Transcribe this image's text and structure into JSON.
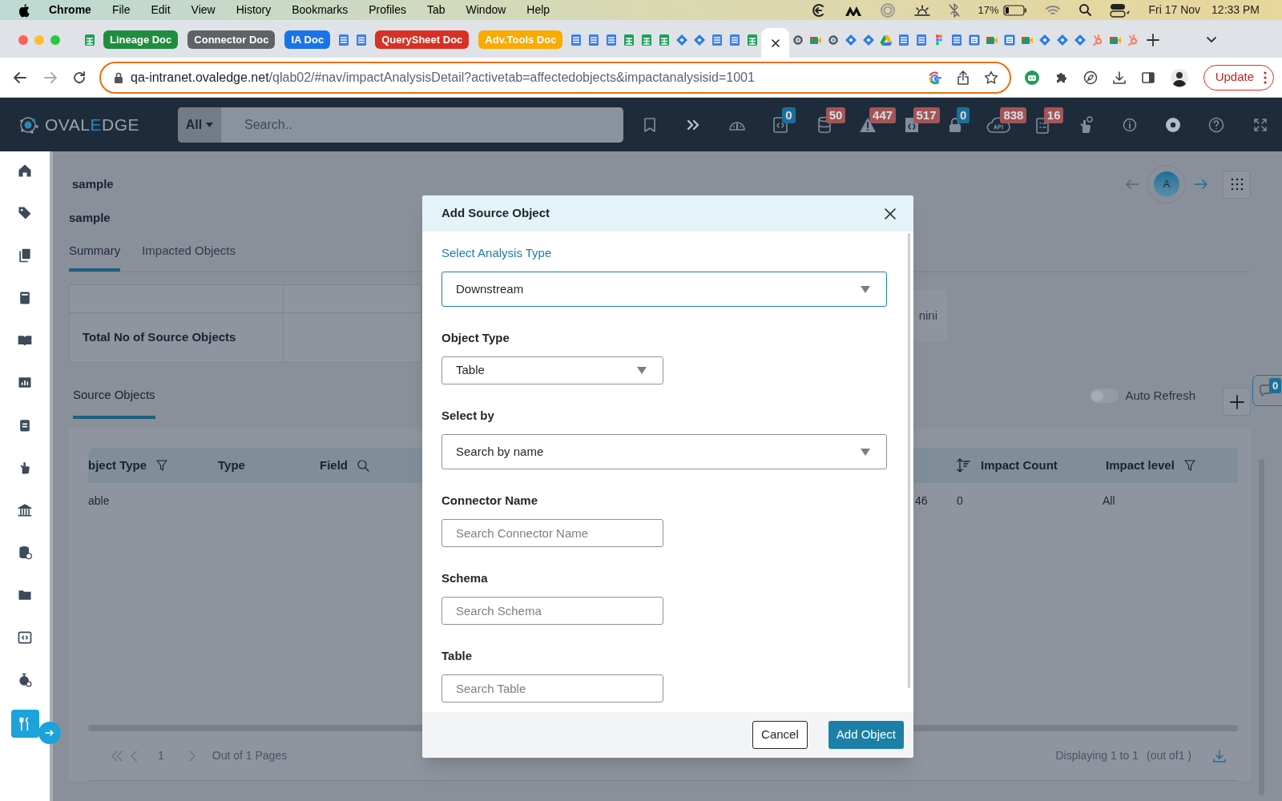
{
  "menu_bar": {
    "app": "Chrome",
    "menus": [
      "File",
      "Edit",
      "View",
      "History",
      "Bookmarks",
      "Profiles",
      "Tab",
      "Window",
      "Help"
    ],
    "battery": "17%",
    "date": "Fri 17 Nov",
    "time": "12:33 PM"
  },
  "browser": {
    "tabs": [
      {
        "kind": "sheets",
        "selected": false
      },
      {
        "kind": "group",
        "label": "Lineage Doc",
        "color": "#1e8e3e",
        "selected": false
      },
      {
        "kind": "group",
        "label": "Connector Doc",
        "color": "#5f6368",
        "selected": false
      },
      {
        "kind": "group",
        "label": "IA Doc",
        "color": "#1a73e8",
        "selected": false
      },
      {
        "kind": "docs",
        "selected": false
      },
      {
        "kind": "docs",
        "selected": false
      },
      {
        "kind": "group",
        "label": "QuerySheet Doc",
        "color": "#d93025",
        "selected": false
      },
      {
        "kind": "group",
        "label": "Adv.Tools Doc",
        "color": "#f9ab00",
        "selected": false
      },
      {
        "kind": "docs",
        "selected": false
      },
      {
        "kind": "docs",
        "selected": false
      },
      {
        "kind": "docs",
        "selected": false
      },
      {
        "kind": "sheets",
        "selected": false
      },
      {
        "kind": "sheets",
        "selected": false
      },
      {
        "kind": "sheets",
        "selected": false
      },
      {
        "kind": "jira",
        "selected": false
      },
      {
        "kind": "jira",
        "selected": false
      },
      {
        "kind": "docs",
        "selected": false
      },
      {
        "kind": "docs",
        "selected": false
      },
      {
        "kind": "sheets",
        "selected": false
      },
      {
        "kind": "page",
        "selected": true
      },
      {
        "kind": "gear",
        "selected": false
      },
      {
        "kind": "meet",
        "selected": false
      },
      {
        "kind": "gear",
        "selected": false
      },
      {
        "kind": "jira",
        "selected": false
      },
      {
        "kind": "jira",
        "selected": false
      },
      {
        "kind": "drive",
        "selected": false
      },
      {
        "kind": "docs",
        "selected": false
      },
      {
        "kind": "docs",
        "selected": false
      },
      {
        "kind": "figma",
        "selected": false
      },
      {
        "kind": "docs",
        "selected": false
      },
      {
        "kind": "calendar",
        "selected": false
      },
      {
        "kind": "meet",
        "selected": false
      },
      {
        "kind": "calendar",
        "selected": false
      },
      {
        "kind": "meet",
        "selected": false
      },
      {
        "kind": "jira",
        "selected": false
      },
      {
        "kind": "jira",
        "selected": false
      },
      {
        "kind": "jira",
        "selected": false
      },
      {
        "kind": "hubspot",
        "selected": false
      },
      {
        "kind": "meet",
        "selected": false
      },
      {
        "kind": "hubspot",
        "selected": false
      }
    ],
    "url": {
      "host": "qa-intranet.ovaledge.net",
      "path": "/qlab02/#nav/impactAnalysisDetail?activetab=affectedobjects&impactanalysisid=1001"
    },
    "update_button": "Update"
  },
  "app_header": {
    "logo_parts": [
      "OVAL",
      "E",
      "DGE"
    ],
    "search_scope": "All",
    "search_placeholder": "Search..",
    "tools": [
      {
        "kind": "bookmark"
      },
      {
        "kind": "chevrons"
      },
      {
        "kind": "gauge"
      },
      {
        "kind": "code",
        "count": "0",
        "color": "#1f6e99"
      },
      {
        "kind": "database",
        "count": "50",
        "color": "#a35656"
      },
      {
        "kind": "warning",
        "count": "447",
        "color": "#a35656"
      },
      {
        "kind": "codefile",
        "count": "517",
        "color": "#a35656"
      },
      {
        "kind": "lock",
        "count": "0",
        "color": "#1f6e99"
      },
      {
        "kind": "api",
        "count": "838",
        "color": "#a35656"
      },
      {
        "kind": "clipboard",
        "count": "16",
        "color": "#a35656"
      },
      {
        "kind": "hand"
      },
      {
        "kind": "info"
      },
      {
        "kind": "chrome"
      },
      {
        "kind": "help"
      },
      {
        "kind": "expand"
      }
    ]
  },
  "sidebar": [
    {
      "kind": "home",
      "selected": false
    },
    {
      "kind": "tag",
      "selected": false
    },
    {
      "kind": "documents",
      "selected": false
    },
    {
      "kind": "book",
      "selected": false
    },
    {
      "kind": "openbook",
      "selected": false
    },
    {
      "kind": "chart",
      "selected": false
    },
    {
      "kind": "clipboard",
      "selected": false
    },
    {
      "kind": "hand",
      "selected": false
    },
    {
      "kind": "bank",
      "selected": false
    },
    {
      "kind": "database",
      "selected": false
    },
    {
      "kind": "folder",
      "selected": false
    },
    {
      "kind": "code",
      "selected": false
    },
    {
      "kind": "timer",
      "selected": false
    },
    {
      "kind": "tools",
      "selected": true
    }
  ],
  "page": {
    "title": "sample",
    "subtitle": "sample",
    "tabs": [
      {
        "label": "Summary",
        "selected": true
      },
      {
        "label": "Impacted Objects",
        "selected": false
      }
    ],
    "summary": {
      "row_label": "Total No of Source Objects",
      "side_value": "nini"
    },
    "section_tab": {
      "label": "Source Objects",
      "selected": true
    },
    "auto_refresh": {
      "label": "Auto Refresh",
      "on": false
    },
    "chat_count": "0",
    "avatar_initial": "A",
    "table": {
      "columns": [
        {
          "label": "bject Type",
          "kind": "filter"
        },
        {
          "label": "Type",
          "kind": "plain"
        },
        {
          "label": "Field",
          "kind": "search"
        },
        {
          "label": "Impact Count",
          "kind": "sort"
        },
        {
          "label": "Impact level",
          "kind": "filter"
        }
      ],
      "rows": [
        {
          "object_type": "able",
          "column_4": "46",
          "impact_count": "0",
          "impact_level": "All"
        }
      ]
    },
    "pagination": {
      "page": "1",
      "pages_text": "Out of 1 Pages",
      "displaying": "Displaying 1 to 1",
      "total": "(out of1 )"
    }
  },
  "modal": {
    "title": "Add Source Object",
    "fields": [
      {
        "label": "Select Analysis Type",
        "kind": "select",
        "value": "Downstream",
        "focused": true,
        "wide": true
      },
      {
        "label": "Object Type",
        "kind": "select",
        "value": "Table",
        "focused": false,
        "wide": false
      },
      {
        "label": "Select by",
        "kind": "select",
        "value": "Search by name",
        "focused": false,
        "wide": true
      },
      {
        "label": "Connector Name",
        "kind": "input",
        "placeholder": "Search Connector Name",
        "focused": false,
        "wide": false
      },
      {
        "label": "Schema",
        "kind": "input",
        "placeholder": "Search Schema",
        "focused": false,
        "wide": false
      },
      {
        "label": "Table",
        "kind": "input",
        "placeholder": "Search Table",
        "focused": false,
        "wide": false
      }
    ],
    "cancel": "Cancel",
    "submit": "Add Object"
  }
}
